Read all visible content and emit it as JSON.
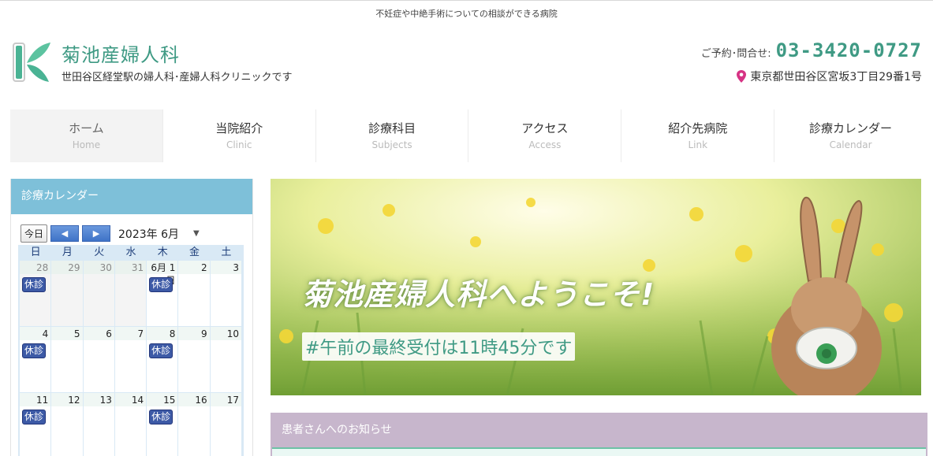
{
  "tagline": "不妊症や中絶手術についての相談ができる病院",
  "header": {
    "title": "菊池産婦人科",
    "subtitle": "世田谷区経堂駅の婦人科･産婦人科クリニックです",
    "phone_label": "ご予約･問合せ:",
    "phone": "03-3420-0727",
    "address": "東京都世田谷区宮坂3丁目29番1号"
  },
  "nav": [
    {
      "jp": "ホーム",
      "en": "Home"
    },
    {
      "jp": "当院紹介",
      "en": "Clinic"
    },
    {
      "jp": "診療科目",
      "en": "Subjects"
    },
    {
      "jp": "アクセス",
      "en": "Access"
    },
    {
      "jp": "紹介先病院",
      "en": "Link"
    },
    {
      "jp": "診療カレンダー",
      "en": "Calendar"
    }
  ],
  "calendar": {
    "heading": "診療カレンダー",
    "today_label": "今日",
    "prev_symbol": "◀",
    "next_symbol": "▶",
    "month_label": "2023年 6月",
    "dropdown_symbol": "▼",
    "weekdays": [
      "日",
      "月",
      "火",
      "水",
      "木",
      "金",
      "土"
    ],
    "weeks": [
      [
        {
          "day": "28",
          "other": true,
          "badge": "休診"
        },
        {
          "day": "29",
          "other": true,
          "badge": ""
        },
        {
          "day": "30",
          "other": true,
          "badge": ""
        },
        {
          "day": "31",
          "other": true,
          "badge": ""
        },
        {
          "day": "6月 1日",
          "other": false,
          "badge": "休診"
        },
        {
          "day": "2",
          "other": false,
          "badge": ""
        },
        {
          "day": "3",
          "other": false,
          "badge": ""
        }
      ],
      [
        {
          "day": "4",
          "other": false,
          "badge": "休診"
        },
        {
          "day": "5",
          "other": false,
          "badge": ""
        },
        {
          "day": "6",
          "other": false,
          "badge": ""
        },
        {
          "day": "7",
          "other": false,
          "badge": ""
        },
        {
          "day": "8",
          "other": false,
          "badge": "休診"
        },
        {
          "day": "9",
          "other": false,
          "badge": ""
        },
        {
          "day": "10",
          "other": false,
          "badge": ""
        }
      ],
      [
        {
          "day": "11",
          "other": false,
          "badge": "休診"
        },
        {
          "day": "12",
          "other": false,
          "badge": ""
        },
        {
          "day": "13",
          "other": false,
          "badge": ""
        },
        {
          "day": "14",
          "other": false,
          "badge": ""
        },
        {
          "day": "15",
          "other": false,
          "badge": "休診"
        },
        {
          "day": "16",
          "other": false,
          "badge": ""
        },
        {
          "day": "17",
          "other": false,
          "badge": ""
        }
      ]
    ]
  },
  "hero": {
    "title": "菊池産婦人科へようこそ!",
    "subtitle": "#午前の最終受付は11時45分です"
  },
  "notice": {
    "heading": "患者さんへのお知らせ"
  },
  "colors": {
    "accent": "#3f9a84",
    "calendar_header": "#7ec0d9",
    "notice_header": "#c7b6cc",
    "badge": "#3d5aa6",
    "pin": "#d63384"
  },
  "icons": [
    "clinic-logo-icon",
    "map-pin-icon",
    "prev-arrow-icon",
    "next-arrow-icon",
    "dropdown-arrow-icon"
  ]
}
